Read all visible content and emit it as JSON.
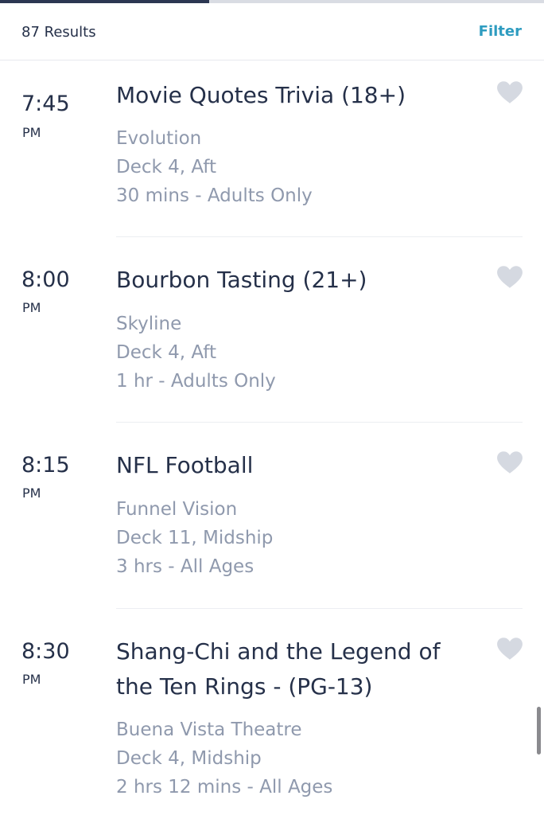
{
  "header": {
    "results_count": "87 Results",
    "filter_label": "Filter",
    "progress": 0.385
  },
  "events": [
    {
      "time": "7:45",
      "ampm": "PM",
      "title": "Movie Quotes Trivia (18+)",
      "venue": "Evolution",
      "location": "Deck 4, Aft",
      "details": "30 mins - Adults Only",
      "favorited": false
    },
    {
      "time": "8:00",
      "ampm": "PM",
      "title": "Bourbon Tasting (21+)",
      "venue": "Skyline",
      "location": "Deck 4, Aft",
      "details": "1 hr - Adults Only",
      "favorited": false
    },
    {
      "time": "8:15",
      "ampm": "PM",
      "title": "NFL Football",
      "venue": "Funnel Vision",
      "location": "Deck 11, Midship",
      "details": "3 hrs - All Ages",
      "favorited": false
    },
    {
      "time": "8:30",
      "ampm": "PM",
      "title": "Shang-Chi and the Legend of the Ten Rings - (PG-13)",
      "venue": "Buena Vista Theatre",
      "location": "Deck 4, Midship",
      "details": "2 hrs 12 mins - All Ages",
      "favorited": false
    }
  ],
  "colors": {
    "primary_text": "#253049",
    "secondary_text": "#8f99ad",
    "accent": "#2e9cc0",
    "heart_inactive": "#d5d9e1"
  },
  "icons": {
    "favorite": "heart-icon"
  }
}
